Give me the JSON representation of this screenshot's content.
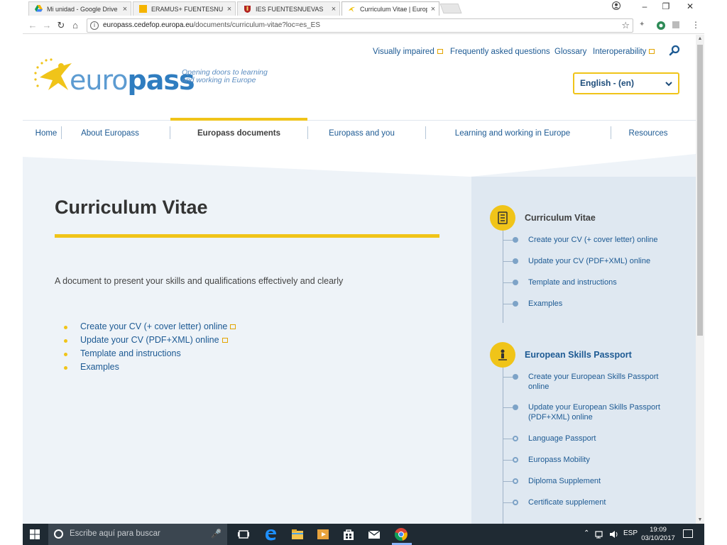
{
  "browser": {
    "tabs": [
      {
        "label": "Mi unidad - Google Drive",
        "close": "×"
      },
      {
        "label": "ERAMUS+ FUENTESNUEVAS",
        "close": "×"
      },
      {
        "label": "IES FUENTESNUEVAS",
        "close": "×"
      },
      {
        "label": "Curriculum Vitae | Europass",
        "close": "×"
      }
    ],
    "url_domain": "europass.cedefop.europa.eu",
    "url_path": "/documents/curriculum-vitae?loc=es_ES",
    "window_controls": [
      "–",
      "❐",
      "✕"
    ],
    "nav": {
      "back": "←",
      "forward": "→",
      "reload": "↻",
      "home": "⌂",
      "star": "☆",
      "menu": "⋮",
      "info": "i"
    }
  },
  "header": {
    "logo_text_light": "euro",
    "logo_text_bold": "pass",
    "tagline_line1": "Opening doors to learning",
    "tagline_line2": "and working in Europe",
    "top_links": [
      "Visually impaired",
      "Frequently asked questions",
      "Glossary",
      "Interoperability"
    ],
    "language": "English - (en)"
  },
  "main_nav": [
    "Home",
    "About Europass",
    "Europass documents",
    "Europass and you",
    "Learning and working in Europe",
    "Resources"
  ],
  "content": {
    "title": "Curriculum Vitae",
    "description": "A document to present your skills and qualifications effectively and clearly",
    "links": [
      "Create your CV (+ cover letter) online",
      "Update your CV (PDF+XML) online",
      "Template and instructions",
      "Examples"
    ]
  },
  "sidebar": {
    "section1_title": "Curriculum Vitae",
    "section1_items": [
      "Create your CV (+ cover letter) online",
      "Update your CV (PDF+XML) online",
      "Template and instructions",
      "Examples"
    ],
    "section2_title": "European Skills Passport",
    "section2_items": [
      "Create your European Skills Passport online",
      "Update your European Skills Passport (PDF+XML) online",
      "Language Passport",
      "Europass Mobility",
      "Diploma Supplement",
      "Certificate supplement"
    ]
  },
  "taskbar": {
    "search_placeholder": "Escribe aquí para buscar",
    "language": "ESP",
    "time": "19:09",
    "date": "03/10/2017"
  },
  "colors": {
    "accent_yellow": "#f0c419",
    "link_blue": "#1d5a93",
    "content_bg": "#eef3f8",
    "sidebar_bg": "#dfe8f1"
  }
}
